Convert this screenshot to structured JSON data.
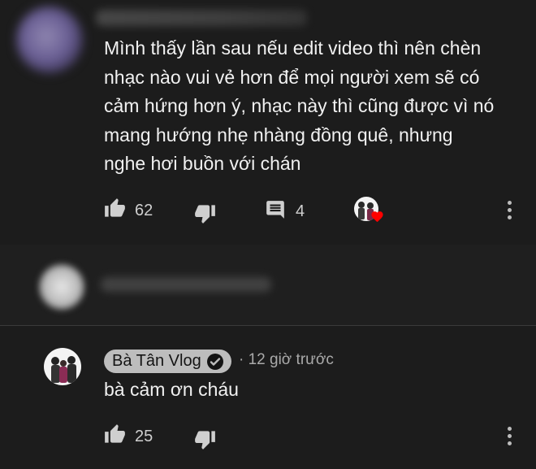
{
  "main_comment": {
    "text": "Mình thấy lần sau nếu edit video thì nên chèn\nnhạc nào vui vẻ hơn để mọi người xem sẽ có\ncảm hứng hơn ý, nhạc này thì cũng được vì nó\nmang hướng nhẹ nhàng đồng quê, nhưng\nnghe hơi buồn với chán",
    "likes": "62",
    "replies": "4"
  },
  "reply": {
    "author": "Bà Tân Vlog",
    "timestamp": "· 12 giờ trước",
    "text": "bà cảm ơn cháu",
    "likes": "25"
  },
  "icons": {
    "like": "thumbs-up-icon",
    "dislike": "thumbs-down-icon",
    "reply": "comment-icon",
    "more": "more-vertical-icon",
    "heart": "heart-icon",
    "verified": "verified-check-icon"
  },
  "colors": {
    "background": "#1c1c1c",
    "text": "#f1f1f1",
    "muted": "#aaaaaa",
    "heart": "#ff0000",
    "chip": "#bdbdbd"
  }
}
